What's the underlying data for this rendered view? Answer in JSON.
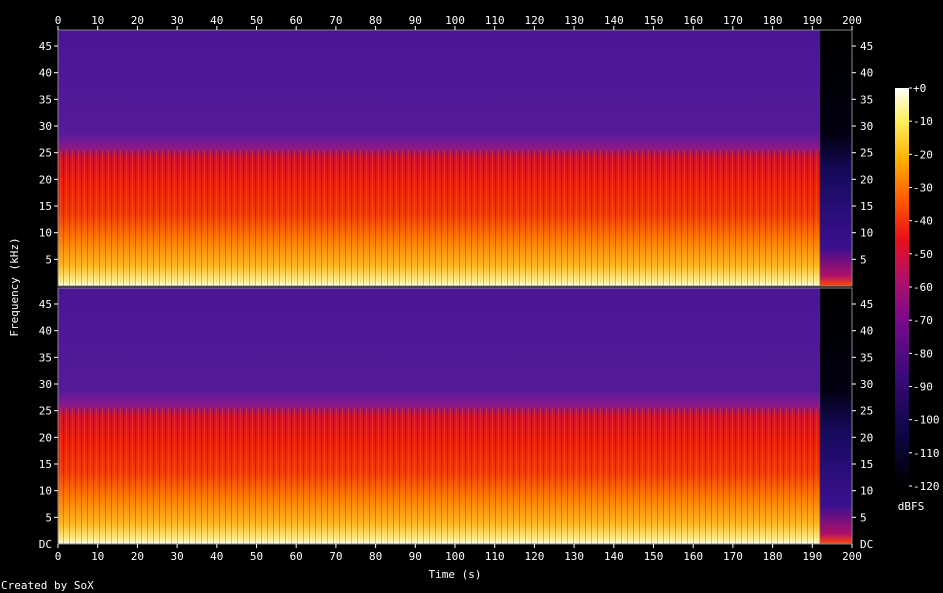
{
  "chart_data": {
    "type": "heatmap",
    "title": "",
    "xlabel": "Time (s)",
    "ylabel": "Frequency (kHz)",
    "x_ticks": [
      0,
      10,
      20,
      30,
      40,
      50,
      60,
      70,
      80,
      90,
      100,
      110,
      120,
      130,
      140,
      150,
      160,
      170,
      180,
      190,
      200
    ],
    "xlim": [
      0,
      200
    ],
    "ylim_khz": [
      0,
      48
    ],
    "channels": [
      {
        "name": "",
        "y_ticks": [
          "5",
          "10",
          "15",
          "20",
          "25",
          "30",
          "35",
          "40",
          "45"
        ],
        "bottom_label": ""
      },
      {
        "name": "",
        "y_ticks": [
          "5",
          "10",
          "15",
          "20",
          "25",
          "30",
          "35",
          "40",
          "45"
        ],
        "bottom_label": "DC"
      }
    ],
    "colorbar": {
      "label": "dBFS",
      "range": [
        -120,
        0
      ],
      "ticks": [
        "+0",
        "-10",
        "-20",
        "-30",
        "-40",
        "-50",
        "-60",
        "-70",
        "-80",
        "-90",
        "-100",
        "-110",
        "-120"
      ]
    },
    "audio_end_seconds": 192,
    "footer": "Created by SoX"
  }
}
